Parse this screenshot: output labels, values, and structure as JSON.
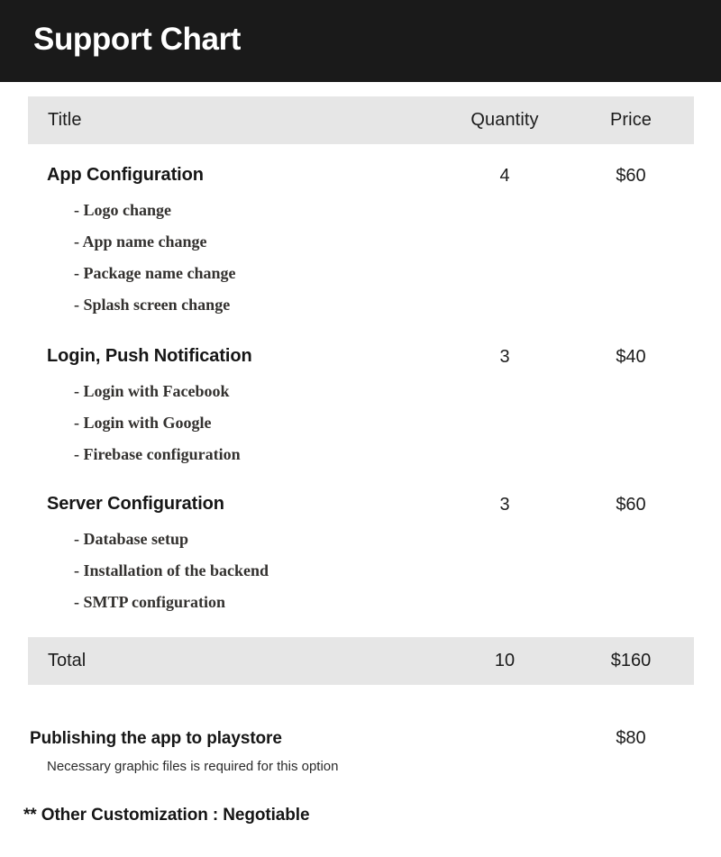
{
  "header": {
    "title": "Support Chart",
    "background_color": "#1a1a1a",
    "text_color": "#ffffff"
  },
  "theme": {
    "band_gray": "#e6e6e6",
    "text_dark": "#161616",
    "page_background": "#ffffff"
  },
  "table": {
    "columns": {
      "title": "Title",
      "quantity": "Quantity",
      "price": "Price"
    },
    "sections": [
      {
        "title": "App Configuration",
        "quantity": "4",
        "price": "$60",
        "items": [
          "- Logo change",
          "- App name change",
          "- Package name change",
          "- Splash screen change"
        ]
      },
      {
        "title": "Login, Push Notification",
        "quantity": "3",
        "price": "$40",
        "items": [
          "- Login with Facebook",
          "- Login with Google",
          "- Firebase configuration"
        ]
      },
      {
        "title": "Server Configuration",
        "quantity": "3",
        "price": "$60",
        "items": [
          "- Database setup",
          "- Installation of the backend",
          "- SMTP configuration"
        ]
      }
    ],
    "total": {
      "label": "Total",
      "quantity": "10",
      "price": "$160"
    }
  },
  "footer": {
    "publish": {
      "title": "Publishing the app to playstore",
      "price": "$80",
      "note": "Necessary graphic files is required for this option"
    },
    "other": "** Other Customization : Negotiable"
  },
  "chart_data": {
    "type": "table",
    "title": "Support Chart",
    "columns": [
      "Title",
      "Quantity",
      "Price"
    ],
    "rows": [
      {
        "title": "App Configuration",
        "quantity": 4,
        "price": 60,
        "price_label": "$60",
        "sub_items": [
          "Logo change",
          "App name change",
          "Package name change",
          "Splash screen change"
        ]
      },
      {
        "title": "Login, Push Notification",
        "quantity": 3,
        "price": 40,
        "price_label": "$40",
        "sub_items": [
          "Login with Facebook",
          "Login with Google",
          "Firebase configuration"
        ]
      },
      {
        "title": "Server Configuration",
        "quantity": 3,
        "price": 60,
        "price_label": "$60",
        "sub_items": [
          "Database setup",
          "Installation of the backend",
          "SMTP configuration"
        ]
      }
    ],
    "total_row": {
      "title": "Total",
      "quantity": 10,
      "price": 160,
      "price_label": "$160"
    },
    "extra_rows": [
      {
        "title": "Publishing the app to playstore",
        "quantity": null,
        "price": 80,
        "price_label": "$80",
        "note": "Necessary graphic files is required for this option"
      }
    ],
    "footnote": "** Other Customization : Negotiable",
    "currency": "USD"
  }
}
